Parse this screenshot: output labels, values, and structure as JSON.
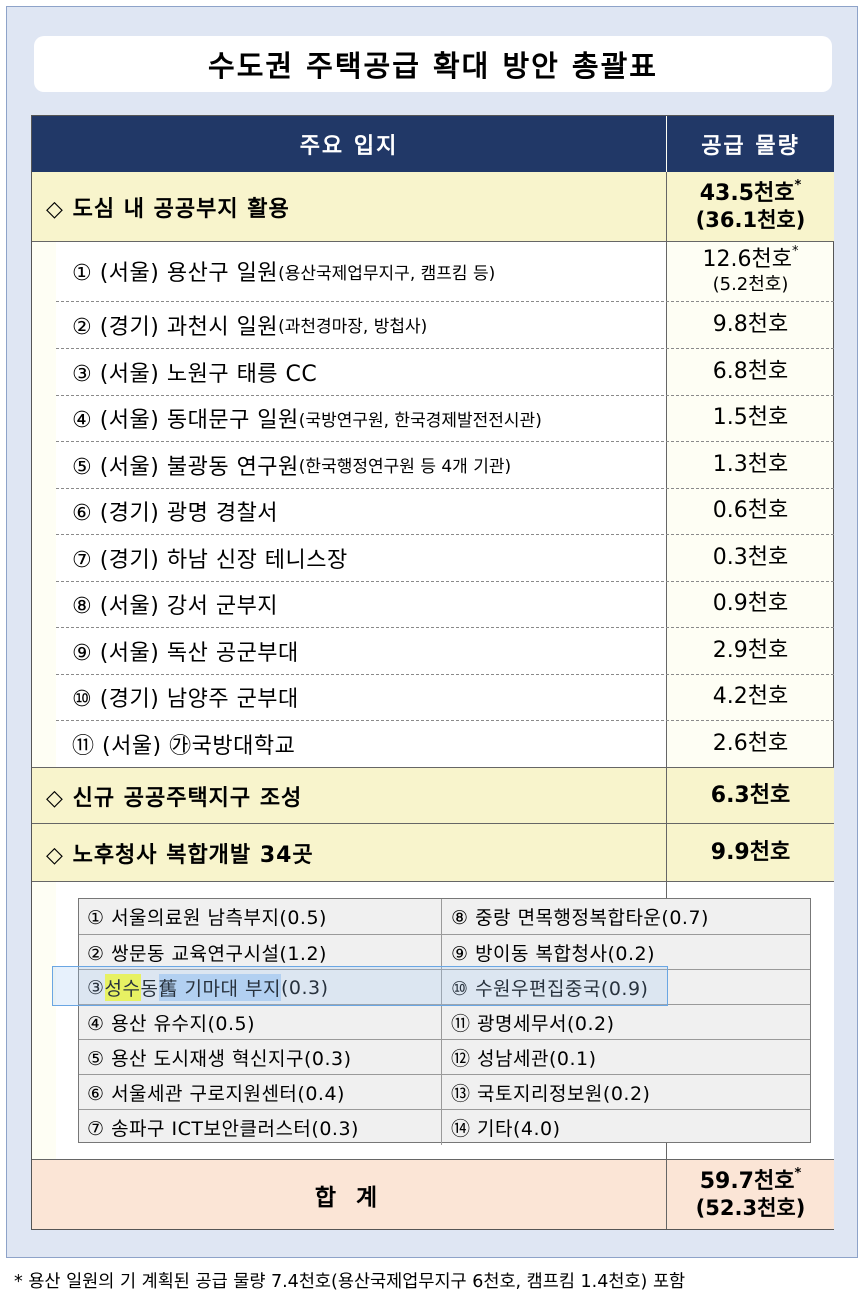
{
  "title": "수도권 주택공급 확대 방안 총괄표",
  "header": {
    "location": "주요 입지",
    "supply": "공급 물량"
  },
  "section1": {
    "label": "◇ 도심 내 공공부지 활용",
    "value": "43.5천호",
    "value_mark": "*",
    "value_paren": "(36.1천호)",
    "items": [
      {
        "main": "① (서울) 용산구 일원",
        "detail": "(용산국제업무지구, 캠프킴 등)",
        "value": "12.6천호",
        "mark": "*",
        "paren": "(5.2천호)"
      },
      {
        "main": "② (경기) 과천시 일원",
        "detail": "(과천경마장, 방첩사)",
        "value": "9.8천호"
      },
      {
        "main": "③ (서울) 노원구 태릉 CC",
        "detail": "",
        "value": "6.8천호"
      },
      {
        "main": "④ (서울) 동대문구 일원",
        "detail": "(국방연구원, 한국경제발전전시관)",
        "value": "1.5천호"
      },
      {
        "main": "⑤ (서울) 불광동 연구원",
        "detail": "(한국행정연구원 등 4개 기관)",
        "value": "1.3천호"
      },
      {
        "main": "⑥ (경기) 광명 경찰서",
        "detail": "",
        "value": "0.6천호"
      },
      {
        "main": "⑦ (경기) 하남 신장 테니스장",
        "detail": "",
        "value": "0.3천호"
      },
      {
        "main": "⑧ (서울) 강서 군부지",
        "detail": "",
        "value": "0.9천호"
      },
      {
        "main": "⑨ (서울) 독산 공군부대",
        "detail": "",
        "value": "2.9천호"
      },
      {
        "main": "⑩ (경기) 남양주 군부대",
        "detail": "",
        "value": "4.2천호"
      },
      {
        "main": "⑪ (서울) ㉮국방대학교",
        "detail": "",
        "value": "2.6천호"
      }
    ]
  },
  "section2": {
    "label": "◇ 신규 공공주택지구 조성",
    "value": "6.3천호"
  },
  "section3": {
    "label": "◇ 노후청사 복합개발 34곳",
    "value": "9.9천호",
    "rows": [
      {
        "left": "① 서울의료원 남측부지(0.5)",
        "right": "⑧ 중랑 면목행정복합타운(0.7)"
      },
      {
        "left": "② 쌍문동 교육연구시설(1.2)",
        "right": "⑨ 방이동 복합청사(0.2)"
      },
      {
        "left_prefix": "③ ",
        "left_hl1": "성수",
        "left_mid": "동 ",
        "left_hl2": "舊 기마대 부지",
        "left_suffix": "(0.3)",
        "right": "⑩ 수원우편집중국(0.9)"
      },
      {
        "left": "④ 용산 유수지(0.5)",
        "right": "⑪ 광명세무서(0.2)"
      },
      {
        "left": "⑤ 용산 도시재생 혁신지구(0.3)",
        "right": "⑫ 성남세관(0.1)"
      },
      {
        "left": "⑥ 서울세관 구로지원센터(0.4)",
        "right": "⑬ 국토지리정보원(0.2)"
      },
      {
        "left": "⑦ 송파구 ICT보안클러스터(0.3)",
        "right": "⑭ 기타(4.0)"
      }
    ]
  },
  "total": {
    "label": "합 계",
    "value": "59.7천호",
    "mark": "*",
    "paren": "(52.3천호)"
  },
  "footnote": "* 용산 일원의 기 계획된 공급 물량 7.4천호(용산국제업무지구 6천호, 캠프킴 1.4천호) 포함",
  "colors": {
    "header_bg": "#213867",
    "section_bg": "#f8f4cc",
    "total_bg": "#fbe5d6",
    "frame_bg": "#dfe6f3"
  }
}
